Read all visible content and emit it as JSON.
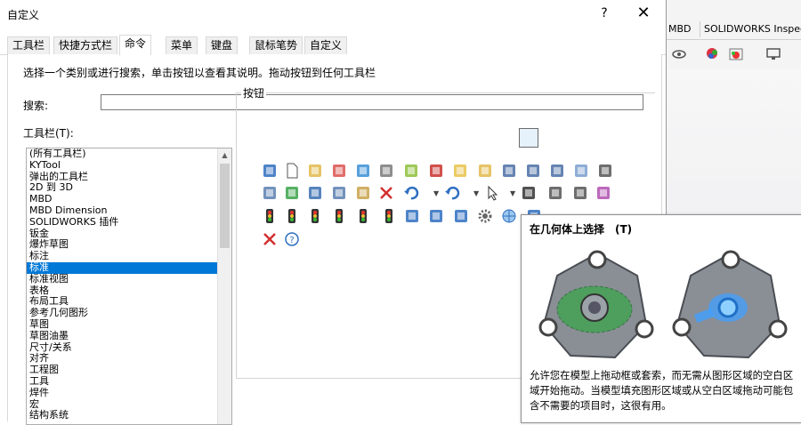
{
  "dialog": {
    "title": "自定义",
    "help": "?",
    "close": "✕",
    "tabs": [
      "工具栏",
      "快捷方式栏",
      "命令",
      "菜单",
      "键盘",
      "鼠标笔势",
      "自定义"
    ],
    "active_tab": "命令",
    "description": "选择一个类别或进行搜索，单击按钮以查看其说明。拖动按钮到任何工具栏",
    "search_label": "搜索:",
    "search_value": "",
    "toolbars_label": "工具栏(T):",
    "categories": [
      "(所有工具栏)",
      "KYTool",
      "弹出的工具栏",
      "2D 到 3D",
      "MBD",
      "MBD Dimension",
      "SOLIDWORKS 插件",
      "钣金",
      "爆炸草图",
      "标注",
      "标准",
      "标准视图",
      "表格",
      "布局工具",
      "参考几何图形",
      "草图",
      "草图油墨",
      "尺寸/关系",
      "对齐",
      "工程图",
      "工具",
      "焊件",
      "宏",
      "结构系统"
    ],
    "selected_category": "标准",
    "buttons_label": "按钮",
    "button_rows": [
      [
        "home-icon",
        "new-document-icon",
        "open-folder-icon",
        "make-drawing-icon",
        "rebuild-icon",
        "options-icon",
        "recent-icon",
        "toolbox-icon",
        "file-properties-icon",
        "assembly-icon",
        "save-icon",
        "save-all-icon",
        "copy-files-icon",
        "print-preview-icon",
        "print-icon"
      ],
      [
        "make-assembly-icon",
        "browser-icon",
        "cut-icon",
        "copy-icon",
        "paste-icon",
        "delete-icon",
        "undo-icon",
        "redo-icon",
        "select-icon",
        "select-over-geometry-icon",
        "magnified-selection-icon",
        "box-select-icon",
        "selection-filter-icon"
      ],
      [
        "traffic-light-icon",
        "traffic-light-2-icon",
        "traffic-light-3-icon",
        "traffic-light-4-icon",
        "traffic-light-5-icon",
        "traffic-light-6-icon",
        "list-icon",
        "table-icon",
        "table-2-icon",
        "gear-icon",
        "globe-icon",
        "move-icon"
      ],
      [
        "red-x-icon",
        "help-icon"
      ]
    ]
  },
  "tooltip": {
    "title": "在几何体上选择　(T)",
    "text": "允许您在模型上拖动框或套索，而无需从图形区域的空白区域开始拖动。当模型填充图形区域或从空白区域拖动可能包含不需要的项目时，这很有用。"
  },
  "background_app": {
    "tabs": [
      "MBD",
      "SOLIDWORKS Inspec"
    ]
  },
  "colors": {
    "selection": "#0078d7",
    "tooltip_glow": "#40a0ff",
    "part_green": "#3aa34a"
  }
}
